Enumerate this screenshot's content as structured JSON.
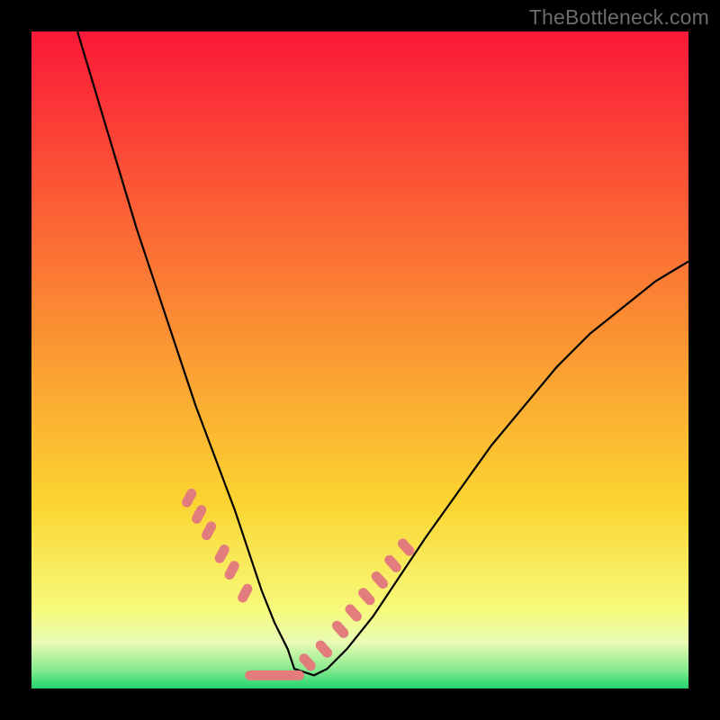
{
  "watermark": {
    "text": "TheBottleneck.com"
  },
  "chart_data": {
    "type": "line",
    "title": "",
    "xlabel": "",
    "ylabel": "",
    "xlim": [
      0,
      100
    ],
    "ylim": [
      0,
      100
    ],
    "grid": false,
    "legend": false,
    "series": [
      {
        "name": "bottleneck-curve",
        "color": "#000000",
        "x": [
          7,
          10,
          13,
          16,
          19,
          22,
          25,
          28,
          31,
          33,
          35,
          37,
          39,
          40,
          43,
          45,
          48,
          52,
          56,
          60,
          65,
          70,
          75,
          80,
          85,
          90,
          95,
          100
        ],
        "values": [
          100,
          90,
          80,
          70,
          61,
          52,
          43,
          35,
          27,
          21,
          15,
          10,
          6,
          3,
          2,
          3,
          6,
          11,
          17,
          23,
          30,
          37,
          43,
          49,
          54,
          58,
          62,
          65
        ]
      },
      {
        "name": "scatter-markers-left",
        "color": "#e37d7d",
        "x": [
          24,
          25.5,
          27,
          29,
          30.5,
          32.5
        ],
        "values": [
          29,
          26.5,
          24,
          20.5,
          18,
          14.5
        ]
      },
      {
        "name": "scatter-markers-right",
        "color": "#e37d7d",
        "x": [
          42,
          44.5,
          47,
          49,
          51,
          53,
          55,
          57
        ],
        "values": [
          4,
          6,
          9,
          11.5,
          14,
          16.5,
          19,
          21.5
        ]
      },
      {
        "name": "scatter-markers-bottom",
        "color": "#e37d7d",
        "x": [
          34,
          35.5,
          37,
          38.5,
          40
        ],
        "values": [
          2,
          2,
          2,
          2,
          2
        ]
      }
    ],
    "background_gradient": {
      "top": "#fb1838",
      "mid": "#fbd531",
      "lower": "#f7fa7c",
      "band": "#e9fbb4",
      "bottom": "#21d56f"
    }
  }
}
